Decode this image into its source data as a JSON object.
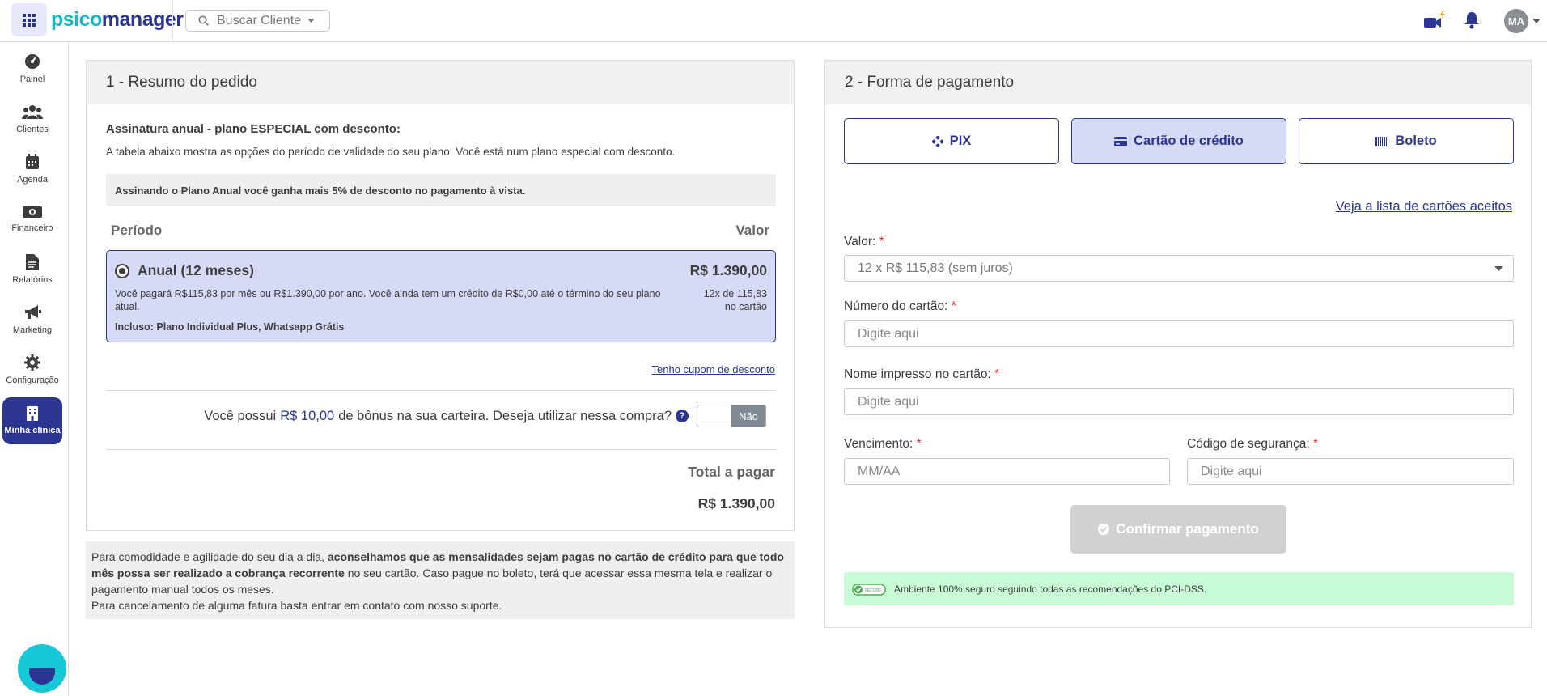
{
  "app": {
    "logo_part1": "psico",
    "logo_part2": "manager",
    "search_label": "Buscar Cliente",
    "avatar_initials": "MA"
  },
  "sidebar": {
    "items": [
      {
        "label": "Painel",
        "icon": "dashboard-icon"
      },
      {
        "label": "Clientes",
        "icon": "users-icon"
      },
      {
        "label": "Agenda",
        "icon": "calendar-icon"
      },
      {
        "label": "Financeiro",
        "icon": "money-icon"
      },
      {
        "label": "Relatórios",
        "icon": "report-icon"
      },
      {
        "label": "Marketing",
        "icon": "megaphone-icon"
      },
      {
        "label": "Configuração",
        "icon": "gear-icon"
      },
      {
        "label": "Minha clínica",
        "icon": "building-icon"
      }
    ]
  },
  "order": {
    "heading": "1 - Resumo do pedido",
    "subscription_title": "Assinatura anual - plano ESPECIAL com desconto:",
    "subscription_desc": "A tabela abaixo mostra as opções do período de validade do seu plano. Você está num plano especial com desconto.",
    "promo": "Assinando o Plano Anual você ganha mais 5% de desconto no pagamento à vista.",
    "col_period": "Período",
    "col_value": "Valor",
    "plan": {
      "name": "Anual (12 meses)",
      "price": "R$ 1.390,00",
      "desc": "Você pagará R$115,83 por mês ou R$1.390,00 por ano. Você ainda tem um crédito de R$0,00 até o término do seu plano atual.",
      "inst_line1": "12x de 115,83",
      "inst_line2": "no cartão",
      "includes": "Incluso: Plano Individual Plus, Whatsapp Grátis"
    },
    "coupon_link": "Tenho cupom de desconto",
    "bonus_prefix": "Você possui",
    "bonus_amount": "R$ 10,00",
    "bonus_suffix": "de bônus na sua carteira. Deseja utilizar nessa compra?",
    "help_mark": "?",
    "toggle_label": "Não",
    "total_label": "Total a pagar",
    "total_value": "R$ 1.390,00"
  },
  "note": {
    "p1_start": "Para comodidade e agilidade do seu dia a dia,",
    "p1_bold": "aconselhamos que as mensalidades sejam pagas no cartão de crédito para que todo mês possa ser realizado a cobrança recorrente",
    "p1_end": "no seu cartão. Caso pague no boleto, terá que acessar essa mesma tela e realizar o pagamento manual todos os meses.",
    "p2": "Para cancelamento de alguma fatura basta entrar em contato com nosso suporte."
  },
  "payment": {
    "heading": "2 - Forma de pagamento",
    "methods": [
      "PIX",
      "Cartão de crédito",
      "Boleto"
    ],
    "selected_method": "Cartão de crédito",
    "cards_link": "Veja a lista de cartões aceitos",
    "value_label": "Valor:",
    "value_selected": "12 x R$ 115,83 (sem juros)",
    "card_number_label": "Número do cartão:",
    "card_number_placeholder": "Digite aqui",
    "name_label": "Nome impresso no cartão:",
    "name_placeholder": "Digite aqui",
    "expiry_label": "Vencimento:",
    "expiry_placeholder": "MM/AA",
    "cvv_label": "Código de segurança:",
    "cvv_placeholder": "Digite aqui",
    "required_mark": "*",
    "confirm_label": "Confirmar pagamento",
    "secure_text": "Ambiente 100% seguro seguindo todas as recomendações do PCI-DSS.",
    "secure_badge": "SECURE"
  },
  "colors": {
    "brand": "#2a3691",
    "accent": "#16b7c9",
    "selected_bg": "#d6daf7",
    "secure_bg": "#c8fcd6",
    "disabled": "#cfd1d3",
    "required": "#d32f2f"
  }
}
